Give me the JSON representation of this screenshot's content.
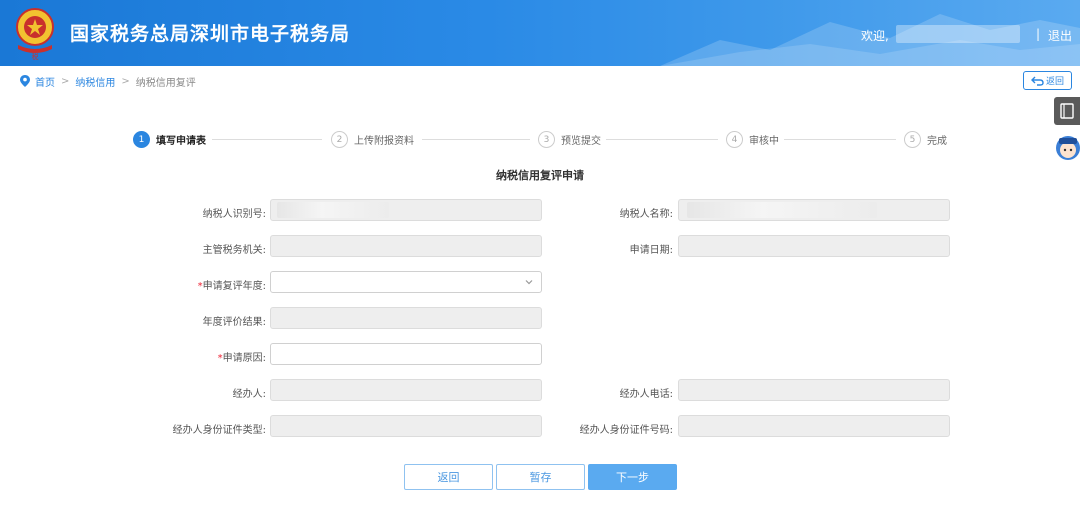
{
  "header": {
    "title": "国家税务总局深圳市电子税务局",
    "welcome": "欢迎,",
    "separator": "|",
    "logout": "退出"
  },
  "breadcrumb": {
    "items": [
      "首页",
      "纳税信用",
      "纳税信用复评"
    ],
    "separator": ">"
  },
  "back_button": {
    "label": "返回"
  },
  "steps": [
    {
      "num": "1",
      "label": "填写申请表"
    },
    {
      "num": "2",
      "label": "上传附报资料"
    },
    {
      "num": "3",
      "label": "预览提交"
    },
    {
      "num": "4",
      "label": "审核中"
    },
    {
      "num": "5",
      "label": "完成"
    }
  ],
  "active_step": 1,
  "form": {
    "title": "纳税信用复评申请",
    "taxpayer_id_label": "纳税人识别号:",
    "taxpayer_name_label": "纳税人名称:",
    "tax_authority_label": "主管税务机关:",
    "apply_date_label": "申请日期:",
    "review_year_label": "申请复评年度:",
    "eval_result_label": "年度评价结果:",
    "reason_label": "申请原因:",
    "agent_label": "经办人:",
    "agent_phone_label": "经办人电话:",
    "agent_id_type_label": "经办人身份证件类型:",
    "agent_id_number_label": "经办人身份证件号码:",
    "required_mark": "*"
  },
  "buttons": {
    "back": "返回",
    "save": "暂存",
    "next": "下一步"
  },
  "colors": {
    "primary": "#2b86e0",
    "header": "#1a78d6",
    "required": "#e23333"
  }
}
